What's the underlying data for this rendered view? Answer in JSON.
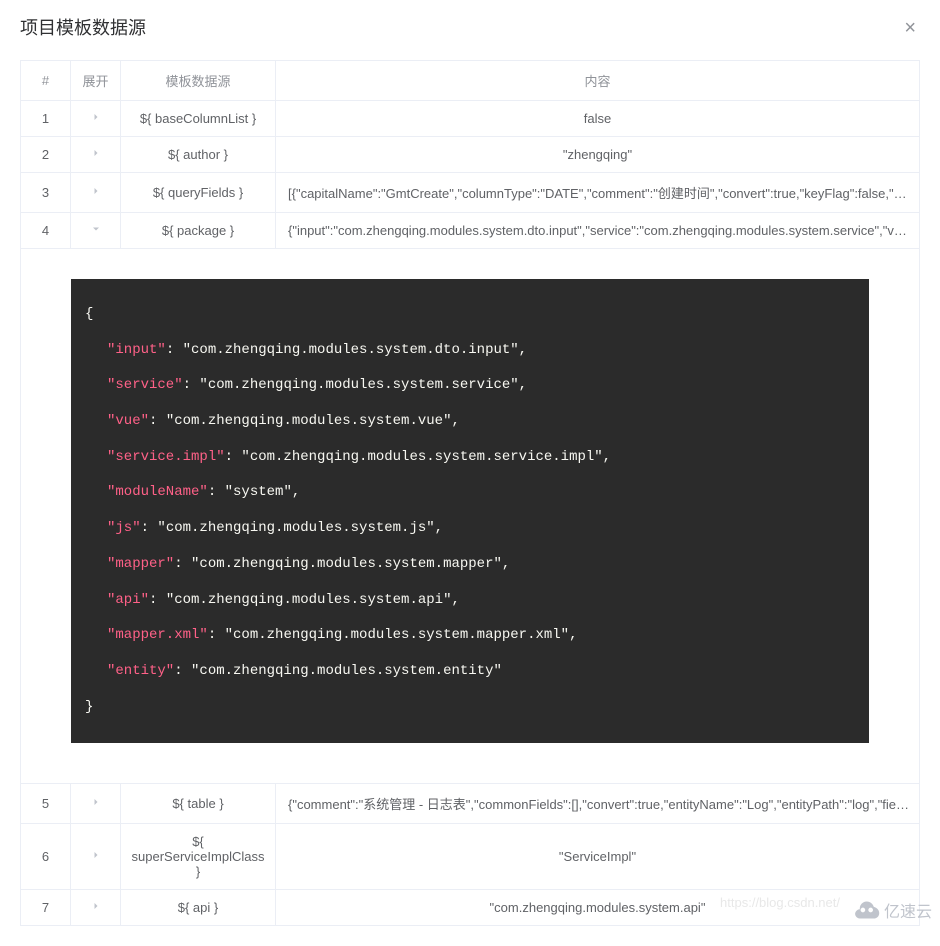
{
  "header": {
    "title": "项目模板数据源",
    "close": "×"
  },
  "table": {
    "headers": {
      "index": "#",
      "expand": "展开",
      "source": "模板数据源",
      "content": "内容"
    },
    "rows": [
      {
        "index": "1",
        "expanded": false,
        "source": "${ baseColumnList }",
        "content": "false",
        "align": "center"
      },
      {
        "index": "2",
        "expanded": false,
        "source": "${ author }",
        "content": "\"zhengqing\"",
        "align": "center"
      },
      {
        "index": "3",
        "expanded": false,
        "source": "${ queryFields }",
        "content": "[{\"capitalName\":\"GmtCreate\",\"columnType\":\"DATE\",\"comment\":\"创建时间\",\"convert\":true,\"keyFlag\":false,\"keyIdentityFlag...",
        "align": "left"
      },
      {
        "index": "4",
        "expanded": true,
        "source": "${ package }",
        "content": "{\"input\":\"com.zhengqing.modules.system.dto.input\",\"service\":\"com.zhengqing.modules.system.service\",\"vue\":\"com.zhen...",
        "align": "left"
      },
      {
        "index": "5",
        "expanded": false,
        "source": "${ table }",
        "content": "{\"comment\":\"系统管理 - 日志表\",\"commonFields\":[],\"convert\":true,\"entityName\":\"Log\",\"entityPath\":\"log\",\"fieldNames\":\"id ...",
        "align": "left"
      },
      {
        "index": "6",
        "expanded": false,
        "source": "${ superServiceImplClass }",
        "content": "\"ServiceImpl\"",
        "align": "center"
      },
      {
        "index": "7",
        "expanded": false,
        "source": "${ api }",
        "content": "\"com.zhengqing.modules.system.api\"",
        "align": "center"
      }
    ]
  },
  "expanded_package": {
    "open": "{",
    "close": "}",
    "entries": [
      {
        "key": "\"input\"",
        "value": ": \"com.zhengqing.modules.system.dto.input\","
      },
      {
        "key": "\"service\"",
        "value": ": \"com.zhengqing.modules.system.service\","
      },
      {
        "key": "\"vue\"",
        "value": ": \"com.zhengqing.modules.system.vue\","
      },
      {
        "key": "\"service.impl\"",
        "value": ": \"com.zhengqing.modules.system.service.impl\","
      },
      {
        "key": "\"moduleName\"",
        "value": ": \"system\","
      },
      {
        "key": "\"js\"",
        "value": ": \"com.zhengqing.modules.system.js\","
      },
      {
        "key": "\"mapper\"",
        "value": ": \"com.zhengqing.modules.system.mapper\","
      },
      {
        "key": "\"api\"",
        "value": ": \"com.zhengqing.modules.system.api\","
      },
      {
        "key": "\"mapper.xml\"",
        "value": ": \"com.zhengqing.modules.system.mapper.xml\","
      },
      {
        "key": "\"entity\"",
        "value": ": \"com.zhengqing.modules.system.entity\""
      }
    ]
  },
  "watermark": "https://blog.csdn.net/",
  "corner_brand": "亿速云"
}
